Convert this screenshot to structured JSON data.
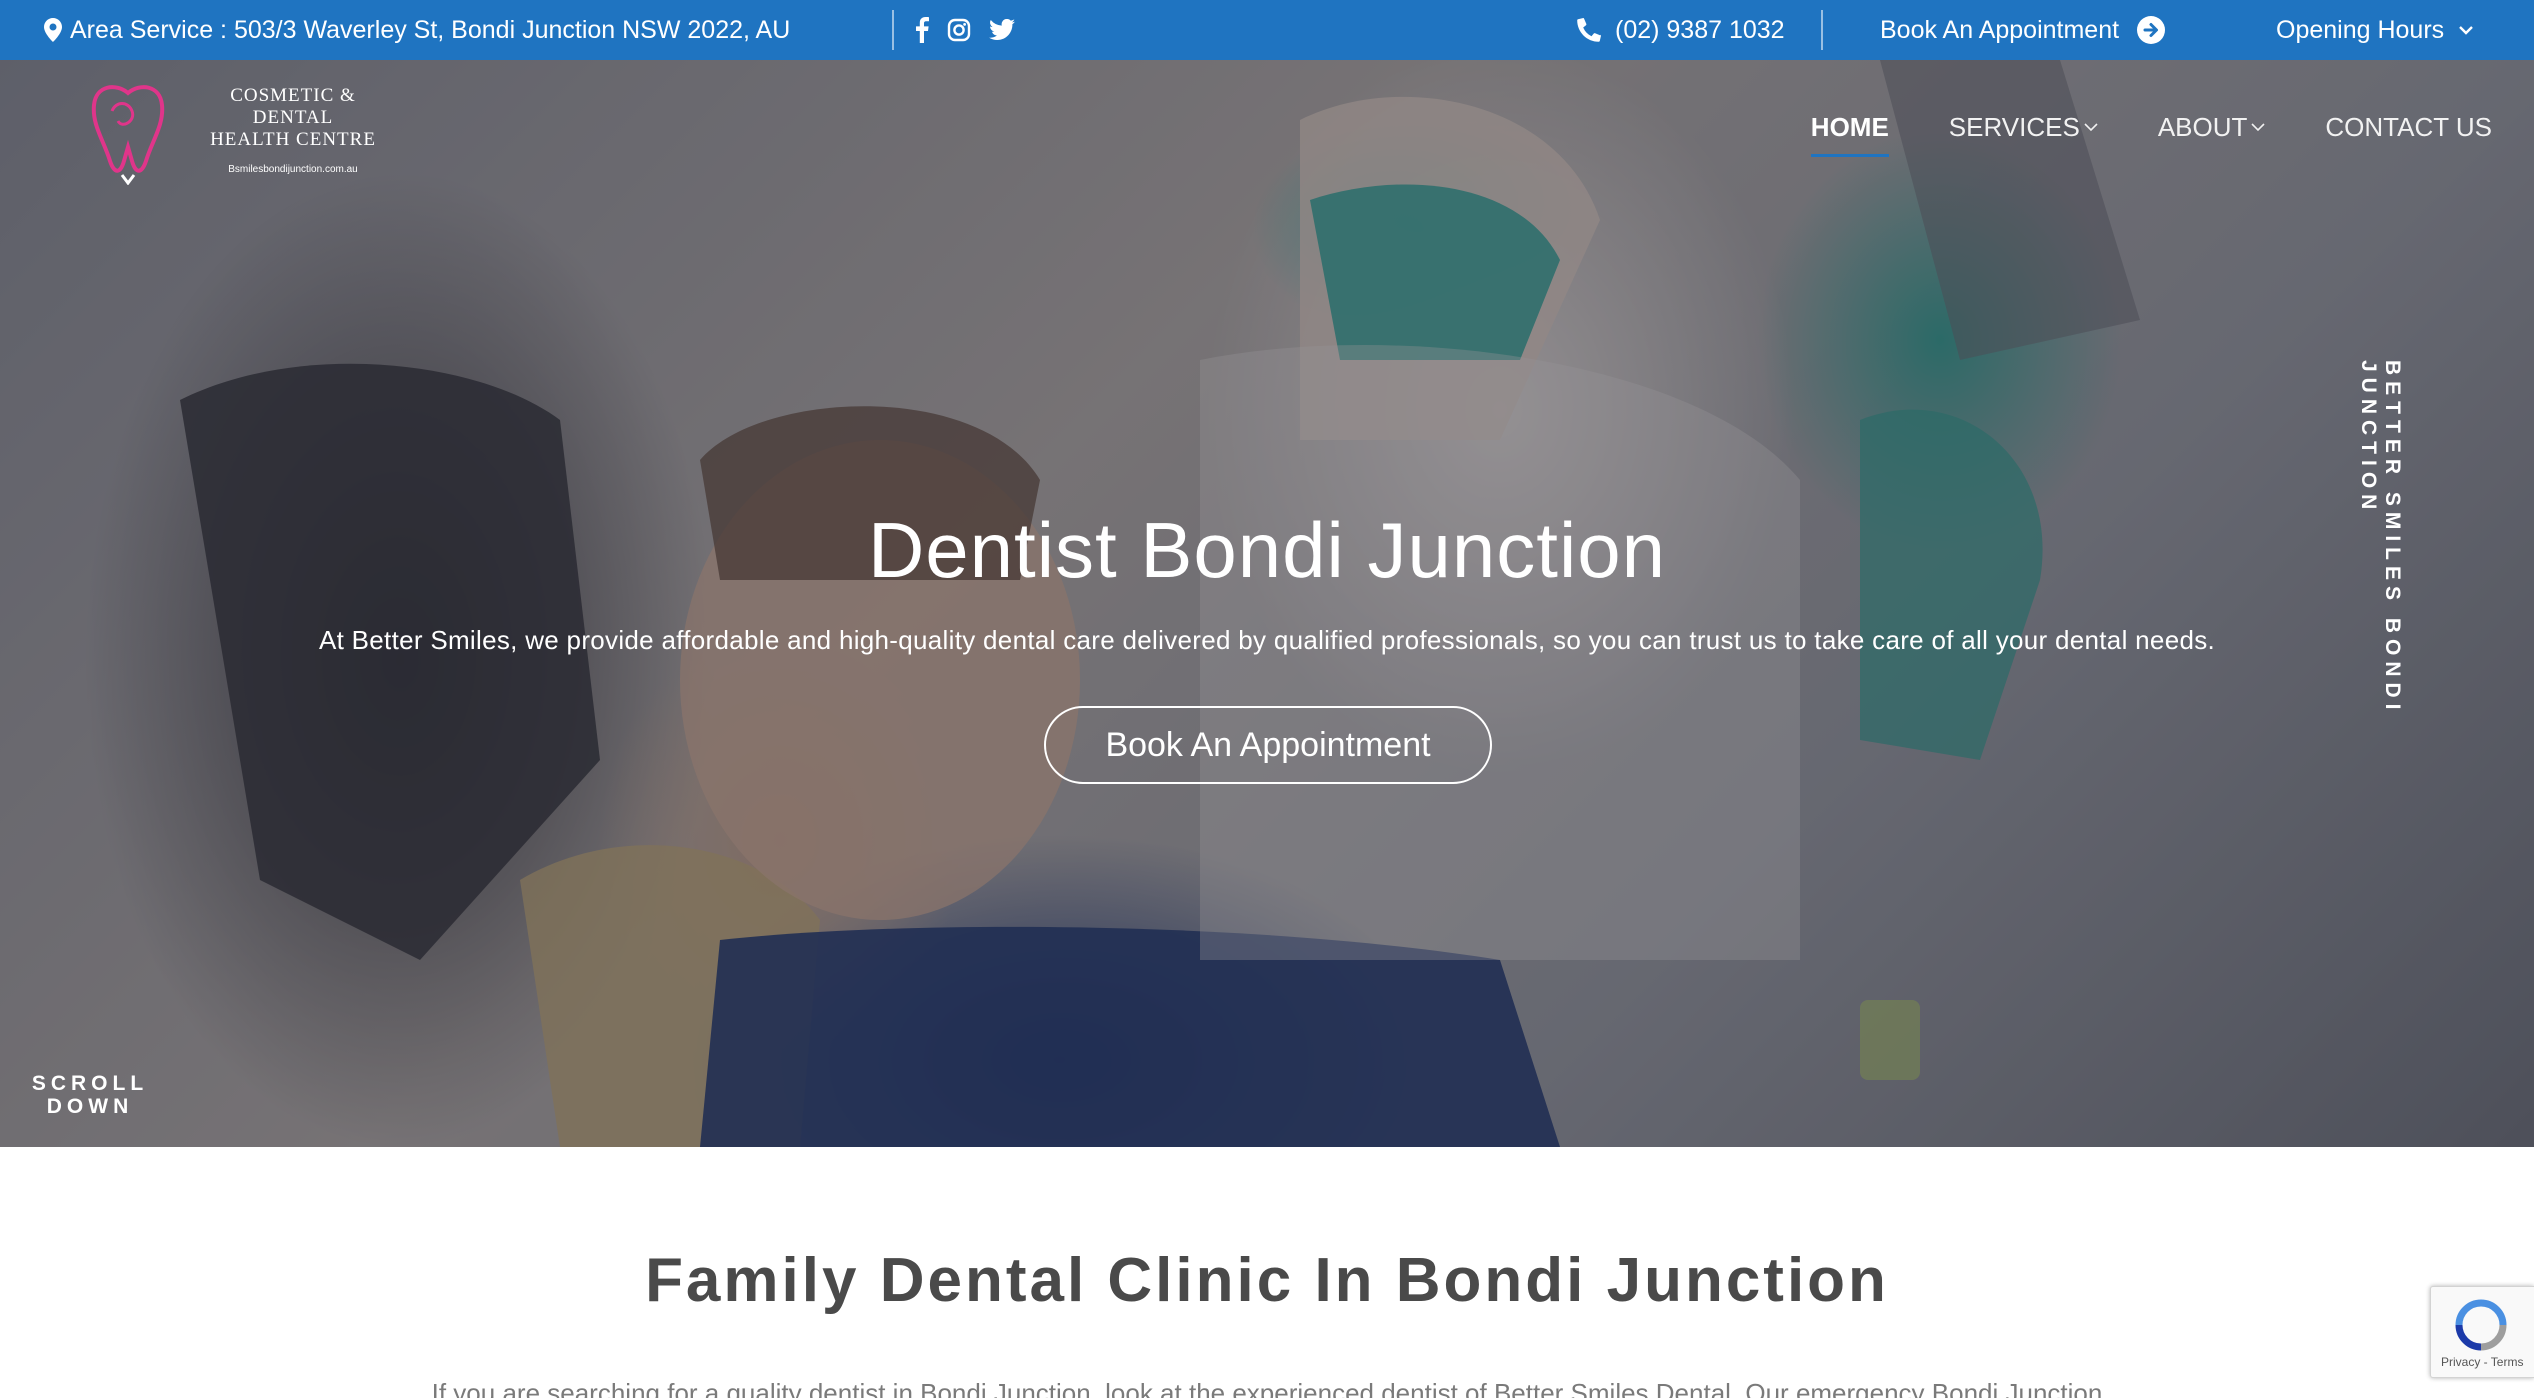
{
  "topbar": {
    "address": "Area Service : 503/3 Waverley St, Bondi Junction NSW 2022, AU",
    "phone": "(02) 9387 1032",
    "book_label": "Book An Appointment",
    "hours_label": "Opening Hours",
    "bg_color": "#1f74c1"
  },
  "logo": {
    "line1": "COSMETIC & DENTAL",
    "line2": "HEALTH CENTRE",
    "line3": "Bsmilesbondijunction.com.au",
    "accent_color": "#e0358a"
  },
  "nav": {
    "items": [
      {
        "label": "HOME",
        "active": true
      },
      {
        "label": "SERVICES",
        "dropdown": true
      },
      {
        "label": "ABOUT",
        "dropdown": true
      },
      {
        "label": "CONTACT US"
      }
    ]
  },
  "hero": {
    "title": "Dentist Bondi Junction",
    "subtitle": "At Better Smiles, we provide affordable and high-quality dental care delivered by qualified professionals, so you can trust us to take care of all your dental needs.",
    "button_label": "Book An Appointment",
    "vertical_text": "BETTER SMILES BONDI JUNCTION",
    "scroll_line1": "SCROLL",
    "scroll_line2": "DOWN"
  },
  "section": {
    "title": "Family Dental Clinic In Bondi Junction",
    "body": "If you are searching for a quality dentist in Bondi Junction, look at the experienced dentist of Better Smiles Dental. Our emergency Bondi Junction"
  },
  "recaptcha": {
    "terms": "Privacy - Terms"
  }
}
